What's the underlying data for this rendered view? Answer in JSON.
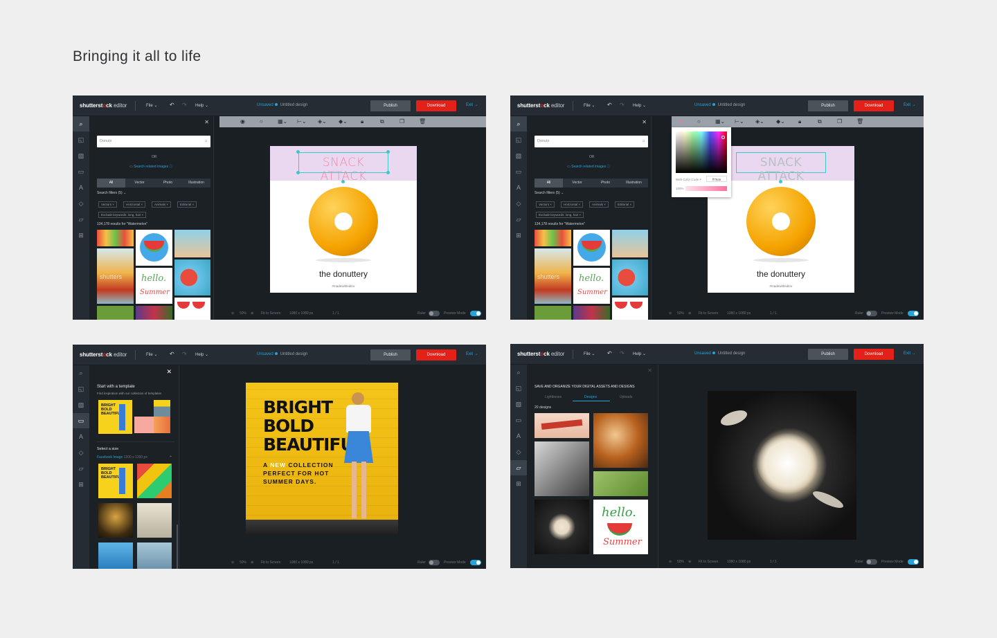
{
  "page": {
    "heading": "Bringing it all to life"
  },
  "editor": {
    "logo_brand": "shutterstck",
    "logo_o": "o",
    "logo_suffix": "editor",
    "menu_file": "File",
    "menu_help": "Help",
    "status_unsaved": "Unsaved",
    "design_name": "Untitled design",
    "publish_label": "Publish",
    "download_label": "Download",
    "exit_label": "Exit"
  },
  "bottom": {
    "zoom": "50%",
    "fit": "Fit to Screen",
    "size": "1080 x 1080 px",
    "pages": "1 / 1",
    "ruler": "Ruler",
    "preview": "Preview Mode"
  },
  "search_panel": {
    "query": "Donuts",
    "or": "OR",
    "related": "Search related images",
    "tabs": [
      "All",
      "Vector",
      "Photo",
      "Illustration"
    ],
    "filters_label": "Search filters (5)",
    "chips": [
      "Vectors",
      "Horizontal",
      "Animals",
      "Editorial",
      "Exclude keywords: long, hair"
    ],
    "results": "134,178 results for \"Watermelon\""
  },
  "design": {
    "headline": "SNACK ATTACK",
    "brand": "the donuttery",
    "hashtag": "#madewitheditor"
  },
  "color_picker": {
    "web_code_label": "Web Color Code #",
    "web_code_value": "ff79a5",
    "opacity": "100%",
    "accent_color": "#ff6fa0"
  },
  "template_panel": {
    "title": "Start with a template",
    "subtitle": "Find inspiration with our collection of templates",
    "size_title": "Select a size",
    "size_name": "Facebook Image",
    "size_dims": "1200 x 1200 px"
  },
  "template_design": {
    "line1": "BRIGHT",
    "line2": "BOLD",
    "line3": "BEAUTIFUL",
    "tag1_a": "A",
    "tag1_new": "NEW",
    "tag1_b": "COLLECTION",
    "tag2": "PERFECT FOR HOT",
    "tag3": "SUMMER DAYS."
  },
  "assets_panel": {
    "title": "SAVE AND ORGANIZE YOUR DIGITAL ASSETS AND DESIGNS",
    "tabs": [
      "Lightboxes",
      "Designs",
      "Uploads"
    ],
    "count": "20 designs"
  },
  "thumb_text": {
    "hello": "hello.",
    "summer": "Summer",
    "watermark": "shutters"
  },
  "colors": {
    "accent_blue": "#27a3d8",
    "download_red": "#e32119",
    "donut_orange": "#f5a300",
    "header_pink": "#ead8f0"
  }
}
